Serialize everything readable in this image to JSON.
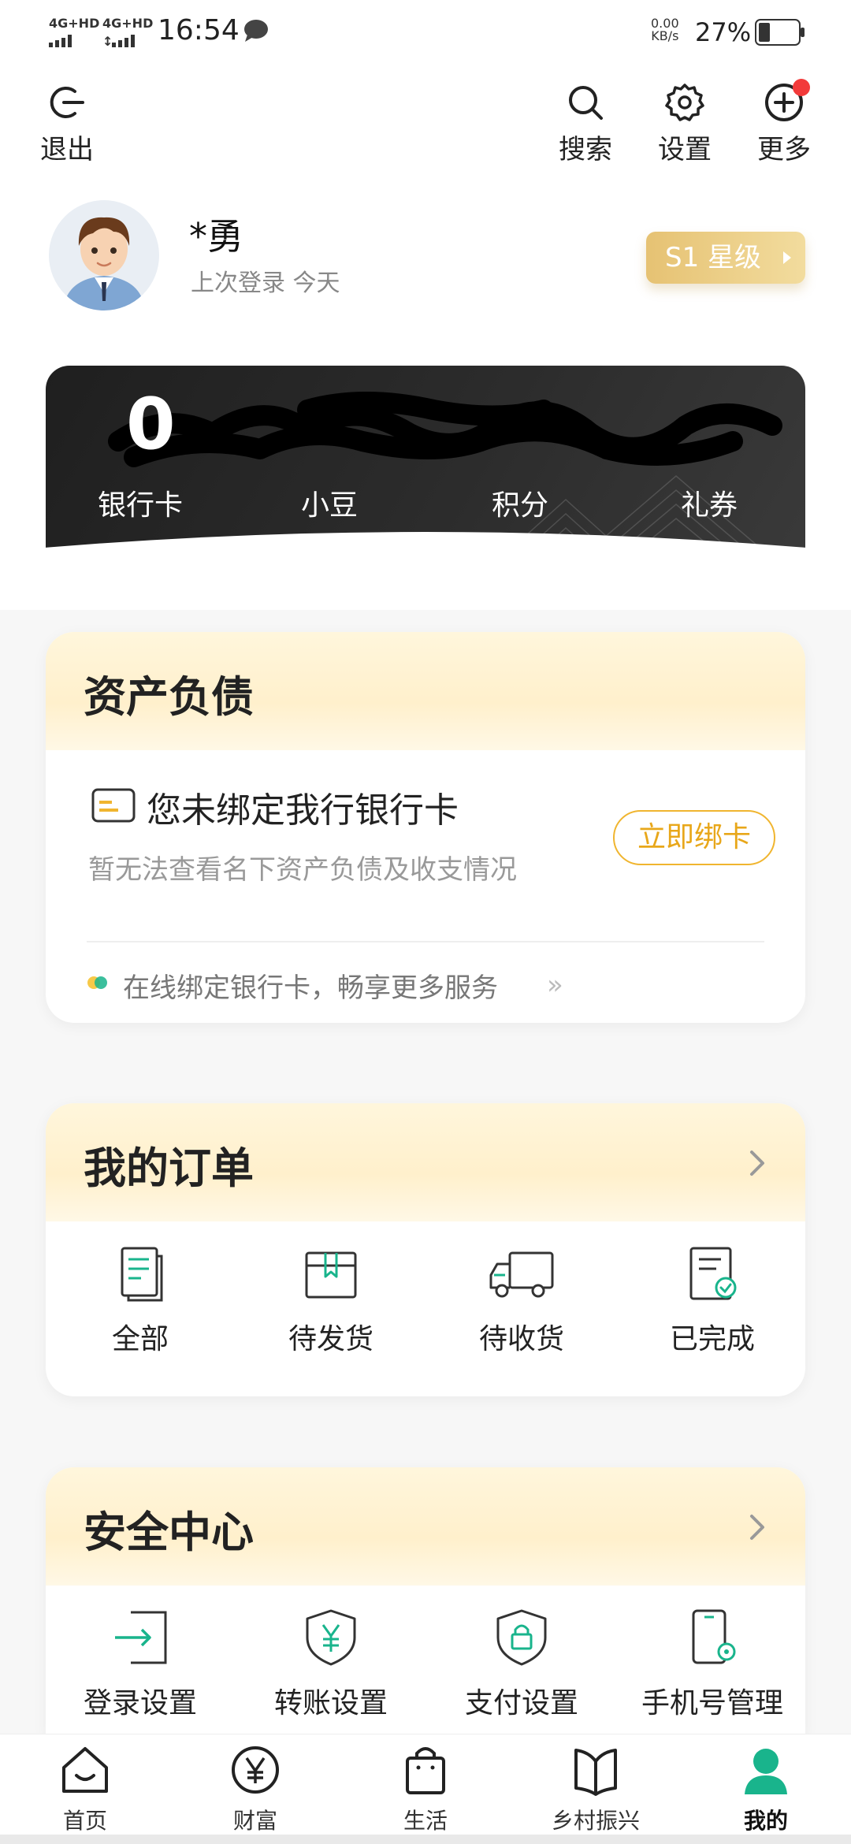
{
  "status_bar": {
    "sim1": "4G+HD",
    "sim2": "4G+HD",
    "time": "16:54",
    "net_speed_value": "0.00",
    "net_speed_unit": "KB/s",
    "battery": "27%"
  },
  "header": {
    "exit_label": "退出",
    "search_label": "搜索",
    "settings_label": "设置",
    "more_label": "更多"
  },
  "profile": {
    "name": "*勇",
    "last_login": "上次登录  今天",
    "level": "S1 星级"
  },
  "asset_card": {
    "bank_card_count": "0",
    "stats": [
      "银行卡",
      "小豆",
      "积分",
      "礼券"
    ]
  },
  "assets_section": {
    "title": "资产负债",
    "bind_text": "您未绑定我行银行卡",
    "bind_subtext": "暂无法查看名下资产负债及收支情况",
    "bind_button": "立即绑卡",
    "online_bind": "在线绑定银行卡，畅享更多服务",
    "online_arrow": "»"
  },
  "orders_section": {
    "title": "我的订单",
    "items": [
      "全部",
      "待发货",
      "待收货",
      "已完成"
    ]
  },
  "security_section": {
    "title": "安全中心",
    "items": [
      "登录设置",
      "转账设置",
      "支付设置",
      "手机号管理"
    ]
  },
  "tabbar": {
    "items": [
      "首页",
      "财富",
      "生活",
      "乡村振兴",
      "我的"
    ]
  },
  "colors": {
    "accent_gold": "#e8a71a",
    "accent_green": "#19b48c",
    "badge_red": "#f23a3a"
  }
}
